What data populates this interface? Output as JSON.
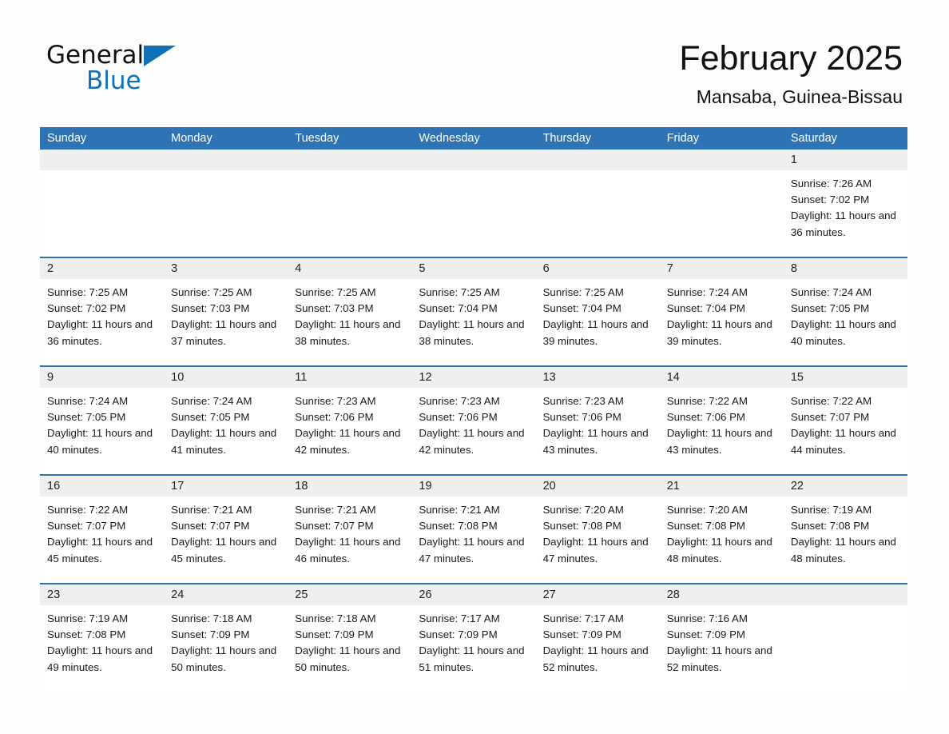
{
  "logo": {
    "text_primary": "General",
    "text_secondary": "Blue",
    "triangle_icon": "blue-triangle-icon",
    "primary_color": "#111111",
    "accent_color": "#1071b8"
  },
  "header": {
    "title": "February 2025",
    "subtitle": "Mansaba, Guinea-Bissau"
  },
  "theme": {
    "header_blue": "#2e74b5",
    "day_band_gray": "#efefef",
    "page_background": "#fdfdfc",
    "text_color": "#1a1a1a"
  },
  "weekdays": [
    "Sunday",
    "Monday",
    "Tuesday",
    "Wednesday",
    "Thursday",
    "Friday",
    "Saturday"
  ],
  "weeks": [
    [
      {
        "day": "",
        "sunrise": "",
        "sunset": "",
        "daylight": "",
        "empty": true
      },
      {
        "day": "",
        "sunrise": "",
        "sunset": "",
        "daylight": "",
        "empty": true
      },
      {
        "day": "",
        "sunrise": "",
        "sunset": "",
        "daylight": "",
        "empty": true
      },
      {
        "day": "",
        "sunrise": "",
        "sunset": "",
        "daylight": "",
        "empty": true
      },
      {
        "day": "",
        "sunrise": "",
        "sunset": "",
        "daylight": "",
        "empty": true
      },
      {
        "day": "",
        "sunrise": "",
        "sunset": "",
        "daylight": "",
        "empty": true
      },
      {
        "day": "1",
        "sunrise": "Sunrise: 7:26 AM",
        "sunset": "Sunset: 7:02 PM",
        "daylight": "Daylight: 11 hours and 36 minutes.",
        "empty": false
      }
    ],
    [
      {
        "day": "2",
        "sunrise": "Sunrise: 7:25 AM",
        "sunset": "Sunset: 7:02 PM",
        "daylight": "Daylight: 11 hours and 36 minutes.",
        "empty": false
      },
      {
        "day": "3",
        "sunrise": "Sunrise: 7:25 AM",
        "sunset": "Sunset: 7:03 PM",
        "daylight": "Daylight: 11 hours and 37 minutes.",
        "empty": false
      },
      {
        "day": "4",
        "sunrise": "Sunrise: 7:25 AM",
        "sunset": "Sunset: 7:03 PM",
        "daylight": "Daylight: 11 hours and 38 minutes.",
        "empty": false
      },
      {
        "day": "5",
        "sunrise": "Sunrise: 7:25 AM",
        "sunset": "Sunset: 7:04 PM",
        "daylight": "Daylight: 11 hours and 38 minutes.",
        "empty": false
      },
      {
        "day": "6",
        "sunrise": "Sunrise: 7:25 AM",
        "sunset": "Sunset: 7:04 PM",
        "daylight": "Daylight: 11 hours and 39 minutes.",
        "empty": false
      },
      {
        "day": "7",
        "sunrise": "Sunrise: 7:24 AM",
        "sunset": "Sunset: 7:04 PM",
        "daylight": "Daylight: 11 hours and 39 minutes.",
        "empty": false
      },
      {
        "day": "8",
        "sunrise": "Sunrise: 7:24 AM",
        "sunset": "Sunset: 7:05 PM",
        "daylight": "Daylight: 11 hours and 40 minutes.",
        "empty": false
      }
    ],
    [
      {
        "day": "9",
        "sunrise": "Sunrise: 7:24 AM",
        "sunset": "Sunset: 7:05 PM",
        "daylight": "Daylight: 11 hours and 40 minutes.",
        "empty": false
      },
      {
        "day": "10",
        "sunrise": "Sunrise: 7:24 AM",
        "sunset": "Sunset: 7:05 PM",
        "daylight": "Daylight: 11 hours and 41 minutes.",
        "empty": false
      },
      {
        "day": "11",
        "sunrise": "Sunrise: 7:23 AM",
        "sunset": "Sunset: 7:06 PM",
        "daylight": "Daylight: 11 hours and 42 minutes.",
        "empty": false
      },
      {
        "day": "12",
        "sunrise": "Sunrise: 7:23 AM",
        "sunset": "Sunset: 7:06 PM",
        "daylight": "Daylight: 11 hours and 42 minutes.",
        "empty": false
      },
      {
        "day": "13",
        "sunrise": "Sunrise: 7:23 AM",
        "sunset": "Sunset: 7:06 PM",
        "daylight": "Daylight: 11 hours and 43 minutes.",
        "empty": false
      },
      {
        "day": "14",
        "sunrise": "Sunrise: 7:22 AM",
        "sunset": "Sunset: 7:06 PM",
        "daylight": "Daylight: 11 hours and 43 minutes.",
        "empty": false
      },
      {
        "day": "15",
        "sunrise": "Sunrise: 7:22 AM",
        "sunset": "Sunset: 7:07 PM",
        "daylight": "Daylight: 11 hours and 44 minutes.",
        "empty": false
      }
    ],
    [
      {
        "day": "16",
        "sunrise": "Sunrise: 7:22 AM",
        "sunset": "Sunset: 7:07 PM",
        "daylight": "Daylight: 11 hours and 45 minutes.",
        "empty": false
      },
      {
        "day": "17",
        "sunrise": "Sunrise: 7:21 AM",
        "sunset": "Sunset: 7:07 PM",
        "daylight": "Daylight: 11 hours and 45 minutes.",
        "empty": false
      },
      {
        "day": "18",
        "sunrise": "Sunrise: 7:21 AM",
        "sunset": "Sunset: 7:07 PM",
        "daylight": "Daylight: 11 hours and 46 minutes.",
        "empty": false
      },
      {
        "day": "19",
        "sunrise": "Sunrise: 7:21 AM",
        "sunset": "Sunset: 7:08 PM",
        "daylight": "Daylight: 11 hours and 47 minutes.",
        "empty": false
      },
      {
        "day": "20",
        "sunrise": "Sunrise: 7:20 AM",
        "sunset": "Sunset: 7:08 PM",
        "daylight": "Daylight: 11 hours and 47 minutes.",
        "empty": false
      },
      {
        "day": "21",
        "sunrise": "Sunrise: 7:20 AM",
        "sunset": "Sunset: 7:08 PM",
        "daylight": "Daylight: 11 hours and 48 minutes.",
        "empty": false
      },
      {
        "day": "22",
        "sunrise": "Sunrise: 7:19 AM",
        "sunset": "Sunset: 7:08 PM",
        "daylight": "Daylight: 11 hours and 48 minutes.",
        "empty": false
      }
    ],
    [
      {
        "day": "23",
        "sunrise": "Sunrise: 7:19 AM",
        "sunset": "Sunset: 7:08 PM",
        "daylight": "Daylight: 11 hours and 49 minutes.",
        "empty": false
      },
      {
        "day": "24",
        "sunrise": "Sunrise: 7:18 AM",
        "sunset": "Sunset: 7:09 PM",
        "daylight": "Daylight: 11 hours and 50 minutes.",
        "empty": false
      },
      {
        "day": "25",
        "sunrise": "Sunrise: 7:18 AM",
        "sunset": "Sunset: 7:09 PM",
        "daylight": "Daylight: 11 hours and 50 minutes.",
        "empty": false
      },
      {
        "day": "26",
        "sunrise": "Sunrise: 7:17 AM",
        "sunset": "Sunset: 7:09 PM",
        "daylight": "Daylight: 11 hours and 51 minutes.",
        "empty": false
      },
      {
        "day": "27",
        "sunrise": "Sunrise: 7:17 AM",
        "sunset": "Sunset: 7:09 PM",
        "daylight": "Daylight: 11 hours and 52 minutes.",
        "empty": false
      },
      {
        "day": "28",
        "sunrise": "Sunrise: 7:16 AM",
        "sunset": "Sunset: 7:09 PM",
        "daylight": "Daylight: 11 hours and 52 minutes.",
        "empty": false
      },
      {
        "day": "",
        "sunrise": "",
        "sunset": "",
        "daylight": "",
        "empty": true
      }
    ]
  ]
}
